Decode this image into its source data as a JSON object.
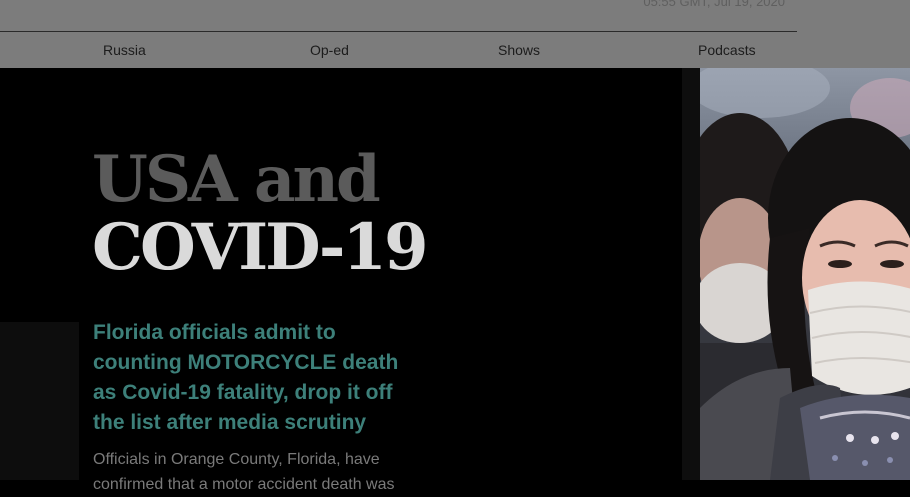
{
  "header": {
    "timestamp": "05:55 GMT, Jul 19, 2020"
  },
  "nav": {
    "items": [
      {
        "label": "Russia"
      },
      {
        "label": "Op-ed"
      },
      {
        "label": "Shows"
      },
      {
        "label": "Podcasts"
      }
    ]
  },
  "feature": {
    "headline_line1": "USA and",
    "headline_line2": "COVID-19"
  },
  "story": {
    "title": "Florida officials admit to counting MOTORCYCLE death as Covid-19 fatality, drop it off the list after media scrutiny",
    "summary": "Officials in Orange County, Florida, have confirmed that a motor accident death was"
  },
  "colors": {
    "background": "#000000",
    "header_bar": "#7c7c7c",
    "headline_dim": "#5b5b5b",
    "headline_bright": "#dadada",
    "story_title": "#3d807a",
    "summary_text": "#7a7a7a"
  }
}
